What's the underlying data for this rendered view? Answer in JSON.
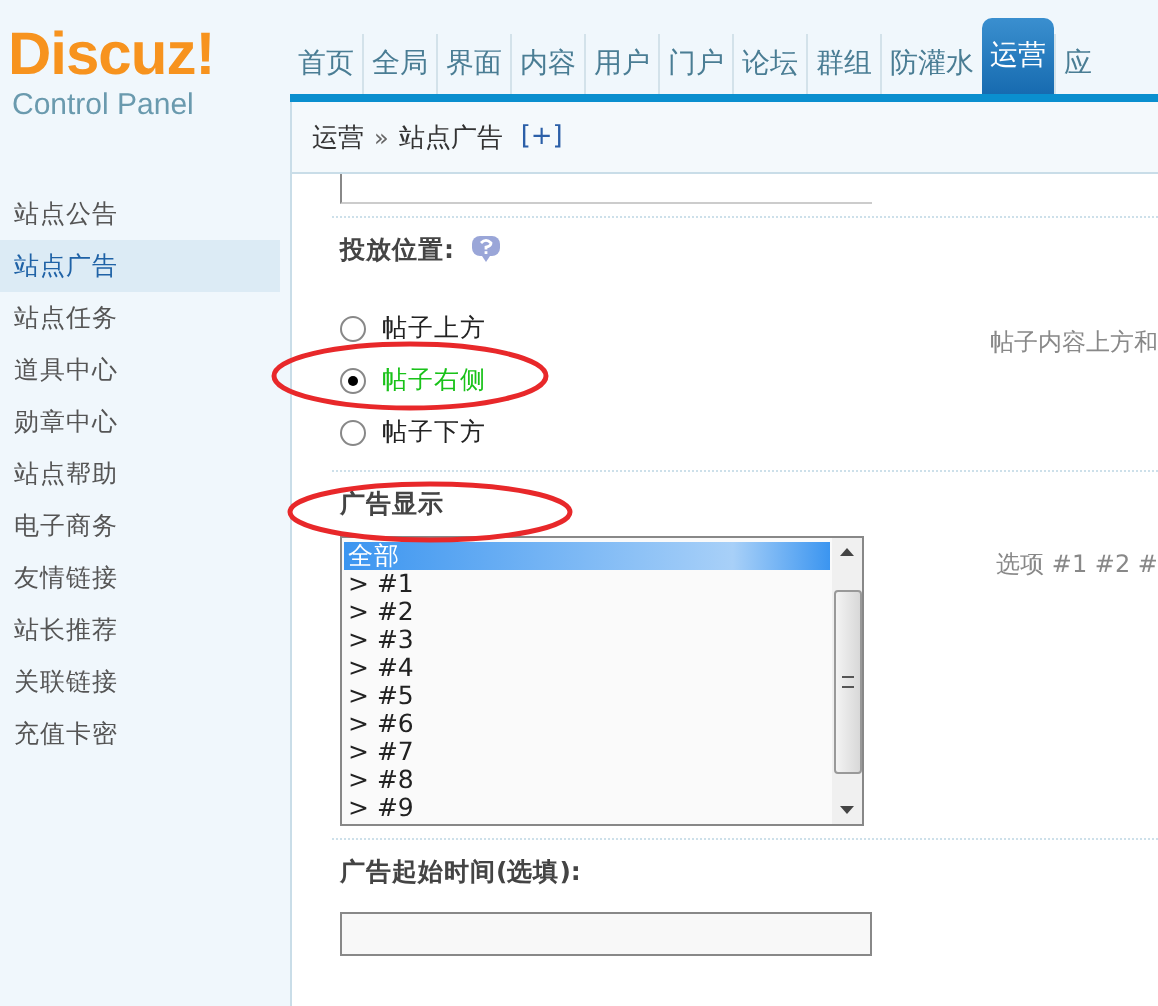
{
  "logo": {
    "brand": "Discuz!",
    "subtitle": "Control Panel"
  },
  "nav": [
    {
      "label": "首页",
      "selected": false
    },
    {
      "label": "全局",
      "selected": false
    },
    {
      "label": "界面",
      "selected": false
    },
    {
      "label": "内容",
      "selected": false
    },
    {
      "label": "用户",
      "selected": false
    },
    {
      "label": "门户",
      "selected": false
    },
    {
      "label": "论坛",
      "selected": false
    },
    {
      "label": "群组",
      "selected": false
    },
    {
      "label": "防灌水",
      "selected": false
    },
    {
      "label": "运营",
      "selected": true
    },
    {
      "label": "应",
      "selected": false
    }
  ],
  "breadcrumb": {
    "section": "运营",
    "separator": "»",
    "page": "站点广告",
    "add": "[+]"
  },
  "sidebar": {
    "items": [
      {
        "label": "站点公告",
        "selected": false
      },
      {
        "label": "站点广告",
        "selected": true
      },
      {
        "label": "站点任务",
        "selected": false
      },
      {
        "label": "道具中心",
        "selected": false
      },
      {
        "label": "勋章中心",
        "selected": false
      },
      {
        "label": "站点帮助",
        "selected": false
      },
      {
        "label": "电子商务",
        "selected": false
      },
      {
        "label": "友情链接",
        "selected": false
      },
      {
        "label": "站长推荐",
        "selected": false
      },
      {
        "label": "关联链接",
        "selected": false
      },
      {
        "label": "充值卡密",
        "selected": false
      }
    ]
  },
  "position": {
    "label": "投放位置:",
    "hint": "帖子内容上方和",
    "options": [
      {
        "label": "帖子上方",
        "selected": false
      },
      {
        "label": "帖子右侧",
        "selected": true
      },
      {
        "label": "帖子下方",
        "selected": false
      }
    ]
  },
  "display": {
    "label": "广告显示",
    "hint": "选项 #1 #2 #",
    "options": [
      {
        "label": "全部",
        "selected": true
      },
      {
        "label": "> #1",
        "selected": false
      },
      {
        "label": "> #2",
        "selected": false
      },
      {
        "label": "> #3",
        "selected": false
      },
      {
        "label": "> #4",
        "selected": false
      },
      {
        "label": "> #5",
        "selected": false
      },
      {
        "label": "> #6",
        "selected": false
      },
      {
        "label": "> #7",
        "selected": false
      },
      {
        "label": "> #8",
        "selected": false
      },
      {
        "label": "> #9",
        "selected": false
      }
    ]
  },
  "start_time": {
    "label": "广告起始时间(选填):"
  }
}
